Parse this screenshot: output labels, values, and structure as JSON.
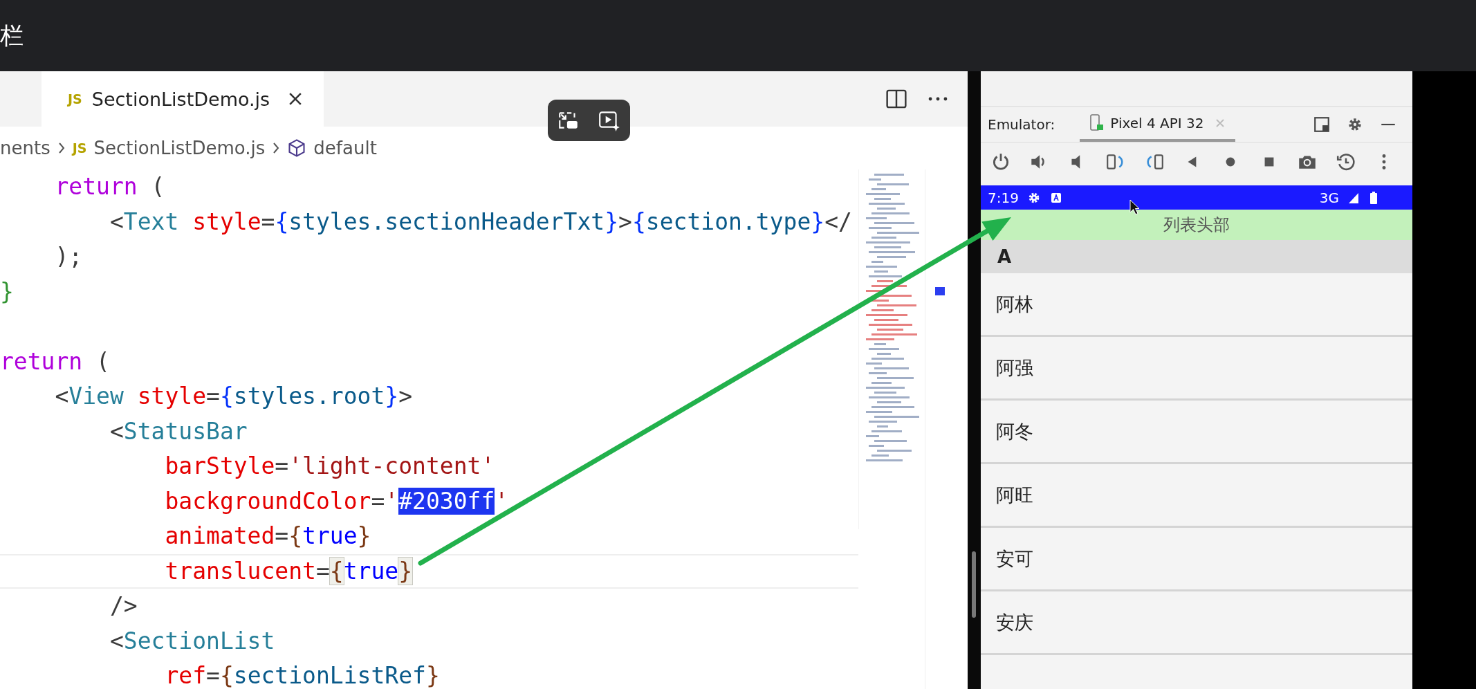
{
  "top_bar": {
    "title": "栏"
  },
  "editor": {
    "tabs": [
      {
        "icon_label": "JS",
        "label": "SectionListDemo.js",
        "selected": true
      }
    ],
    "breadcrumb": [
      {
        "label": "nents",
        "kind": "folder"
      },
      {
        "label": "SectionListDemo.js",
        "kind": "file",
        "icon_label": "JS"
      },
      {
        "label": "default",
        "kind": "symbol"
      }
    ],
    "lines": [
      {
        "current": false,
        "tokens": [
          {
            "text": "    return",
            "kind": "keyword"
          },
          {
            "text": " (",
            "kind": "punct"
          }
        ]
      },
      {
        "current": false,
        "tokens": [
          {
            "text": "        <",
            "kind": "punct"
          },
          {
            "text": "Text ",
            "kind": "tag"
          },
          {
            "text": "style",
            "kind": "attr"
          },
          {
            "text": "=",
            "kind": "punct"
          },
          {
            "text": "{",
            "kind": "brace"
          },
          {
            "text": "styles.sectionHeaderTxt",
            "kind": "var"
          },
          {
            "text": "}",
            "kind": "brace"
          },
          {
            "text": ">",
            "kind": "punct"
          },
          {
            "text": "{",
            "kind": "brace"
          },
          {
            "text": "section.type",
            "kind": "var"
          },
          {
            "text": "}",
            "kind": "brace"
          },
          {
            "text": "</",
            "kind": "punct"
          }
        ]
      },
      {
        "current": false,
        "tokens": [
          {
            "text": "    );",
            "kind": "punct"
          }
        ]
      },
      {
        "current": false,
        "tokens": [
          {
            "text": "}",
            "kind": "brace2"
          }
        ]
      },
      {
        "current": false
      },
      {
        "current": false,
        "tokens": [
          {
            "text": "return",
            "kind": "keyword"
          },
          {
            "text": " (",
            "kind": "punct"
          }
        ]
      },
      {
        "current": false,
        "tokens": [
          {
            "text": "    <",
            "kind": "punct"
          },
          {
            "text": "View ",
            "kind": "tag"
          },
          {
            "text": "style",
            "kind": "attr"
          },
          {
            "text": "=",
            "kind": "punct"
          },
          {
            "text": "{",
            "kind": "brace"
          },
          {
            "text": "styles.root",
            "kind": "var"
          },
          {
            "text": "}",
            "kind": "brace"
          },
          {
            "text": ">",
            "kind": "punct"
          }
        ]
      },
      {
        "current": false,
        "tokens": [
          {
            "text": "        <",
            "kind": "punct"
          },
          {
            "text": "StatusBar",
            "kind": "tag"
          }
        ]
      },
      {
        "current": false,
        "tokens": [
          {
            "text": "            barStyle",
            "kind": "attr"
          },
          {
            "text": "=",
            "kind": "punct"
          },
          {
            "text": "'light-content'",
            "kind": "string"
          }
        ]
      },
      {
        "current": false,
        "tokens": [
          {
            "text": "            backgroundColor",
            "kind": "attr"
          },
          {
            "text": "=",
            "kind": "punct"
          },
          {
            "text": "'",
            "kind": "string"
          },
          {
            "text": "#2030ff",
            "kind": "selection"
          },
          {
            "text": "'",
            "kind": "string"
          }
        ]
      },
      {
        "current": false,
        "tokens": [
          {
            "text": "            animated",
            "kind": "attr"
          },
          {
            "text": "=",
            "kind": "punct"
          },
          {
            "text": "{",
            "kind": "brace3"
          },
          {
            "text": "true",
            "kind": "literal"
          },
          {
            "text": "}",
            "kind": "brace3"
          }
        ]
      },
      {
        "current": true,
        "tokens": [
          {
            "text": "            translucent",
            "kind": "attr"
          },
          {
            "text": "=",
            "kind": "punct"
          },
          {
            "text": "{",
            "kind": "match"
          },
          {
            "text": "true",
            "kind": "literal"
          },
          {
            "text": "}",
            "kind": "match"
          }
        ]
      },
      {
        "current": false,
        "tokens": [
          {
            "text": "        />",
            "kind": "punct"
          }
        ]
      },
      {
        "current": false,
        "tokens": [
          {
            "text": "        <",
            "kind": "punct"
          },
          {
            "text": "SectionList",
            "kind": "tag"
          }
        ]
      },
      {
        "current": false,
        "tokens": [
          {
            "text": "            ref",
            "kind": "attr"
          },
          {
            "text": "=",
            "kind": "punct"
          },
          {
            "text": "{",
            "kind": "brace3"
          },
          {
            "text": "sectionListRef",
            "kind": "var"
          },
          {
            "text": "}",
            "kind": "brace3"
          }
        ]
      }
    ]
  },
  "emulator": {
    "label": "Emulator:",
    "tabs": [
      {
        "label": "Pixel 4 API 32",
        "selected": true
      }
    ],
    "phone": {
      "time": "7:19",
      "network": "3G",
      "list_header": "列表头部",
      "sections": [
        {
          "title": "A",
          "items": [
            "阿林",
            "阿强",
            "阿冬",
            "阿旺",
            "安可",
            "安庆"
          ]
        }
      ]
    }
  }
}
